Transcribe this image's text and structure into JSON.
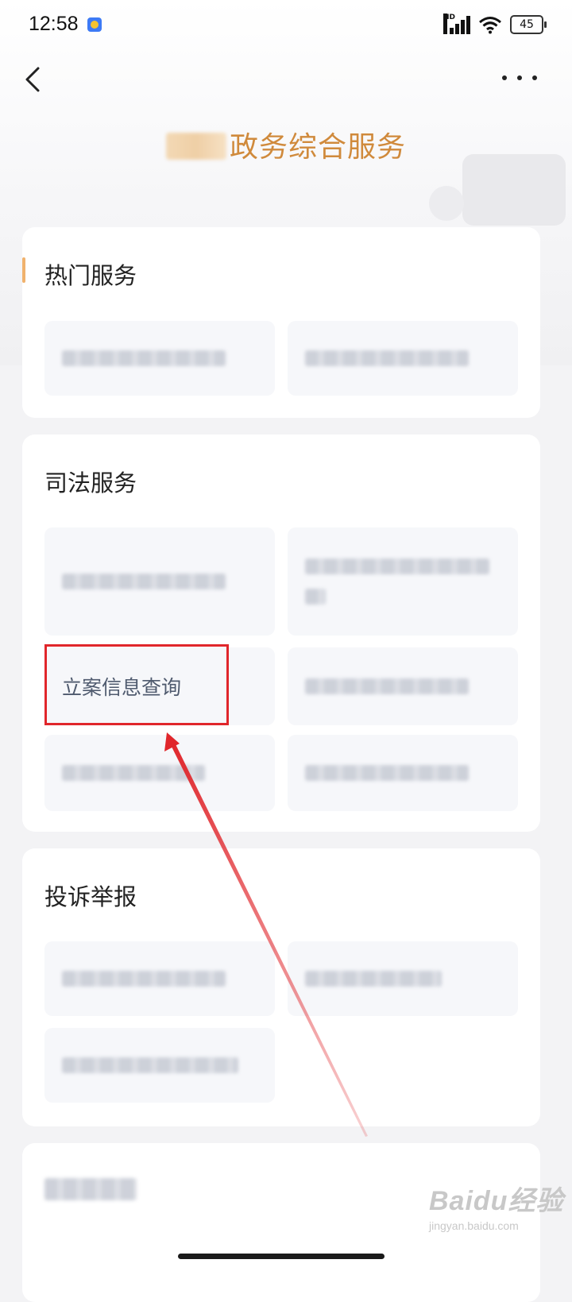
{
  "status_bar": {
    "time": "12:58",
    "network_label": "HD",
    "battery": "45",
    "icons": [
      "app-notification-icon",
      "signal-icon",
      "wifi-icon",
      "battery-icon"
    ]
  },
  "nav": {
    "back_icon": "chevron-left-icon",
    "more_icon": "more-dots-icon"
  },
  "page": {
    "title": "政务综合服务"
  },
  "sections": {
    "hot": {
      "title": "热门服务"
    },
    "judicial": {
      "title": "司法服务",
      "highlighted_item": "立案信息查询"
    },
    "complaint": {
      "title": "投诉举报"
    }
  },
  "watermark": {
    "brand": "Baidu经验",
    "url": "jingyan.baidu.com"
  },
  "colors": {
    "title_orange": "#d08a3c",
    "accent_bar": "#f0b26d",
    "highlight_red": "#e0262b",
    "tile_bg": "#f6f7fa"
  }
}
